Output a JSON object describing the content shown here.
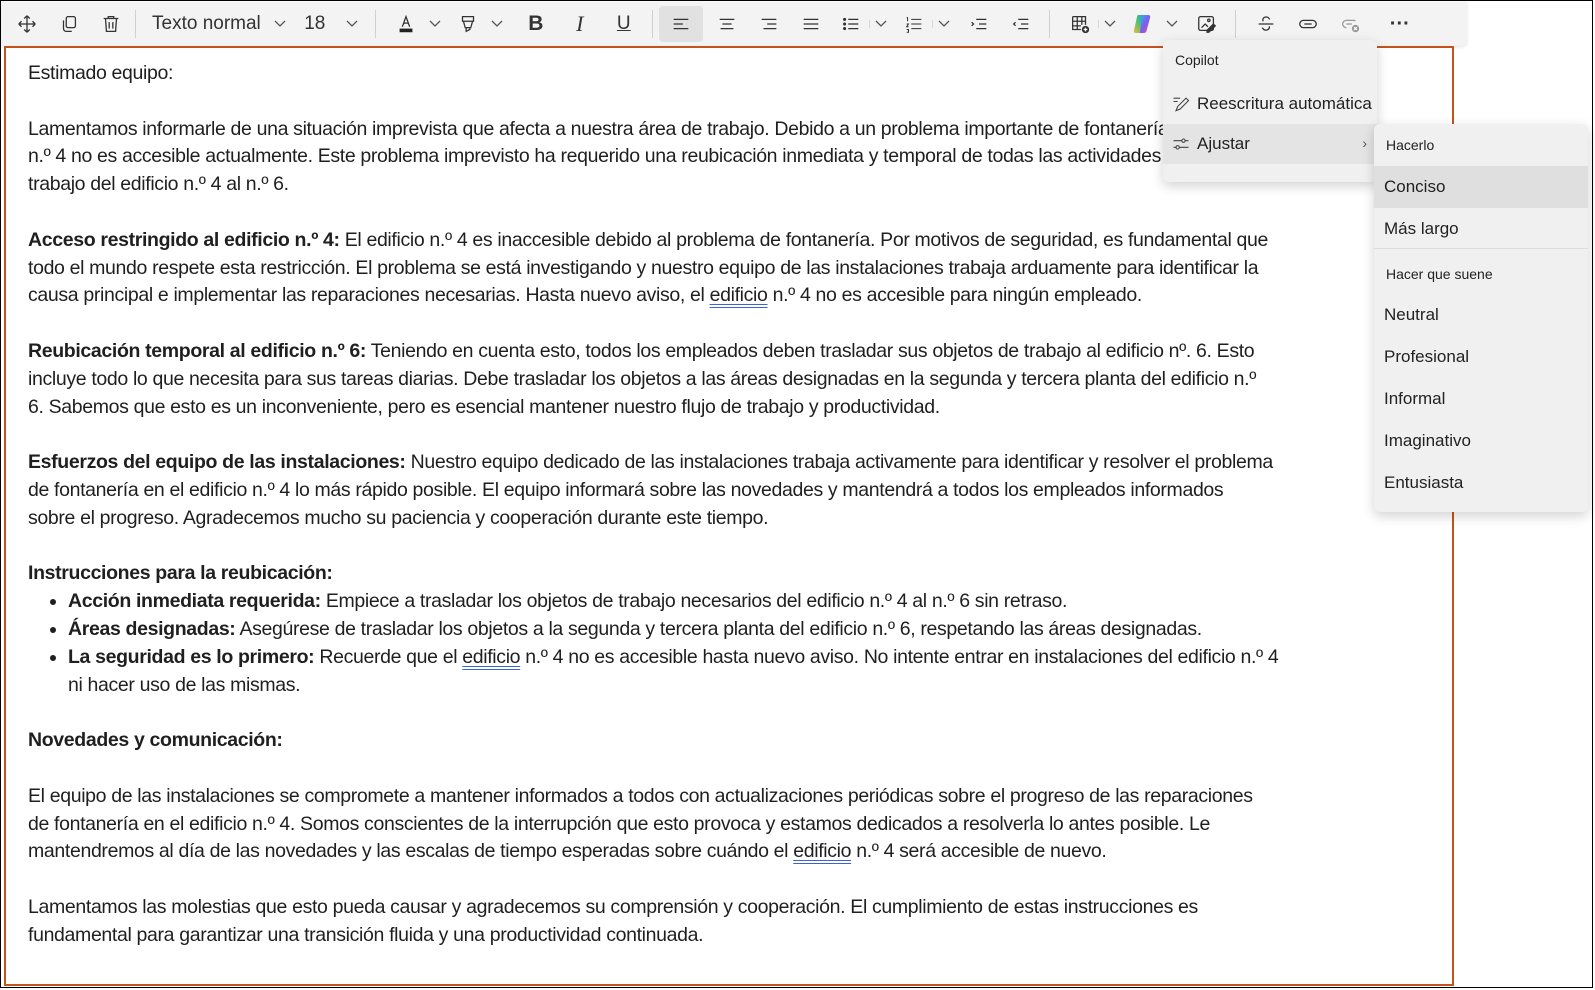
{
  "toolbar": {
    "move_label": "Mover",
    "copy_label": "Copiar",
    "delete_label": "Eliminar",
    "paragraph_style": "Texto normal",
    "font_size": "18",
    "bold_glyph": "B",
    "italic_glyph": "I",
    "underline_glyph": "U",
    "more_glyph": "···",
    "active_alignment": "align-left",
    "colors": {
      "accent_border": "#c4531c",
      "toolbar_bg": "#f3f3f3",
      "menu_bg": "#f0f0f0"
    }
  },
  "copilot_menu": {
    "title": "Copilot",
    "items": [
      {
        "label": "Reescritura automática",
        "icon": "rewrite-pencil-icon"
      },
      {
        "label": "Ajustar",
        "icon": "sliders-icon",
        "has_submenu": true,
        "arrow": "›"
      }
    ]
  },
  "adjust_submenu": {
    "section1_heading": "Hacerlo",
    "section1_items": [
      "Conciso",
      "Más largo"
    ],
    "highlighted_item": "Conciso",
    "section2_heading": "Hacer que suene",
    "section2_items": [
      "Neutral",
      "Profesional",
      "Informal",
      "Imaginativo",
      "Entusiasta"
    ]
  },
  "document": {
    "greeting": "Estimado equipo:",
    "intro": {
      "line1": "Lamentamos informarle de una situación imprevista que afecta a nuestra área de trabajo. Debido a un problema importante de fontanería, el edificio",
      "line2": "n.º 4 no es accesible actualmente. Este problema imprevisto ha requerido una reubicación inmediata y temporal de todas las actividades y objetos de",
      "line3": "trabajo del edificio n.º 4 al n.º 6."
    },
    "section_access": {
      "heading": "Acceso restringido al edificio n.º 4:",
      "line1": " El edificio n.º 4 es inaccesible debido al problema de fontanería. Por motivos de seguridad, es fundamental que",
      "line2": "todo el mundo respete esta restricción. El problema se está investigando y nuestro equipo de las instalaciones trabaja arduamente para identificar la",
      "line3_a": "causa principal e implementar las reparaciones necesarias. Hasta nuevo aviso, el ",
      "line3_word": "edificio",
      "line3_b": " n.º 4 no es accesible para ningún empleado."
    },
    "section_relocation": {
      "heading": "Reubicación temporal al edificio n.º 6:",
      "line1": " Teniendo en cuenta esto, todos los empleados deben trasladar sus objetos de trabajo al edificio nº. 6. Esto",
      "line2": "incluye todo lo que necesita para sus tareas diarias. Debe trasladar los objetos a las áreas designadas en la segunda y tercera planta del edificio n.º",
      "line3": "6. Sabemos que esto es un inconveniente, pero es esencial mantener nuestro flujo de trabajo y productividad."
    },
    "section_efforts": {
      "heading": "Esfuerzos del equipo de las instalaciones:",
      "line1": " Nuestro equipo dedicado de las instalaciones trabaja activamente para identificar y resolver el problema",
      "line2": "de fontanería en el edificio n.º 4 lo más rápido posible. El equipo informará sobre las novedades y mantendrá a todos los empleados informados",
      "line3": "sobre el progreso. Agradecemos mucho su paciencia y cooperación durante este tiempo."
    },
    "instructions": {
      "heading": "Instrucciones para la reubicación:",
      "items": [
        {
          "bold": "Acción inmediata requerida:",
          "text": " Empiece a trasladar los objetos de trabajo necesarios del edificio n.º 4 al n.º 6 sin retraso."
        },
        {
          "bold": "Áreas designadas:",
          "text": " Asegúrese de trasladar los objetos a la segunda y tercera planta del edificio n.º 6, respetando las áreas designadas."
        },
        {
          "bold": "La seguridad es lo primero:",
          "text_a": " Recuerde que el ",
          "word": "edificio",
          "text_b": " n.º 4 no es accesible hasta nuevo aviso. No intente entrar en instalaciones del edificio n.º 4",
          "line2": "ni hacer uso de las mismas."
        }
      ]
    },
    "updates_heading": "Novedades y comunicación:",
    "updates": {
      "line1": "El equipo de las instalaciones se compromete a mantener informados a todos con actualizaciones periódicas sobre el progreso de las reparaciones",
      "line2": "de fontanería en el edificio n.º 4. Somos conscientes de la interrupción que esto provoca y estamos dedicados a resolverla lo antes posible. Le",
      "line3_a": "mantendremos al día de las novedades y las escalas de tiempo esperadas sobre cuándo el ",
      "line3_word": "edificio",
      "line3_b": " n.º 4 será accesible de nuevo."
    },
    "closing": {
      "line1": "Lamentamos las molestias que esto pueda causar y agradecemos su comprensión y cooperación. El cumplimiento de estas instrucciones es",
      "line2": "fundamental para garantizar una transición fluida y una productividad continuada."
    }
  }
}
